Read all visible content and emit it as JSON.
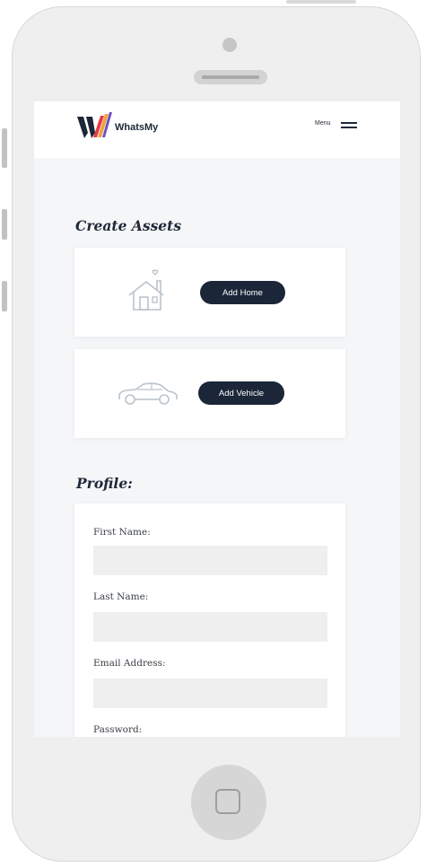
{
  "header": {
    "brand": "WhatsMy",
    "menu_label": "Menu",
    "logo_colors": {
      "dark": "#1b2638",
      "red": "#e63946",
      "orange": "#f0a33a",
      "purple": "#6c4fc4"
    }
  },
  "assets": {
    "title": "Create Assets",
    "items": [
      {
        "icon": "house-icon",
        "button": "Add Home"
      },
      {
        "icon": "car-icon",
        "button": "Add Vehicle"
      }
    ]
  },
  "profile": {
    "title": "Profile:",
    "fields": [
      {
        "label": "First Name:",
        "value": ""
      },
      {
        "label": "Last Name:",
        "value": ""
      },
      {
        "label": "Email Address:",
        "value": ""
      },
      {
        "label": "Password:",
        "value": ""
      }
    ]
  },
  "colors": {
    "primary": "#1b2638",
    "background": "#f5f6f8",
    "input": "#efefef",
    "icon": "#b9c3cc"
  }
}
